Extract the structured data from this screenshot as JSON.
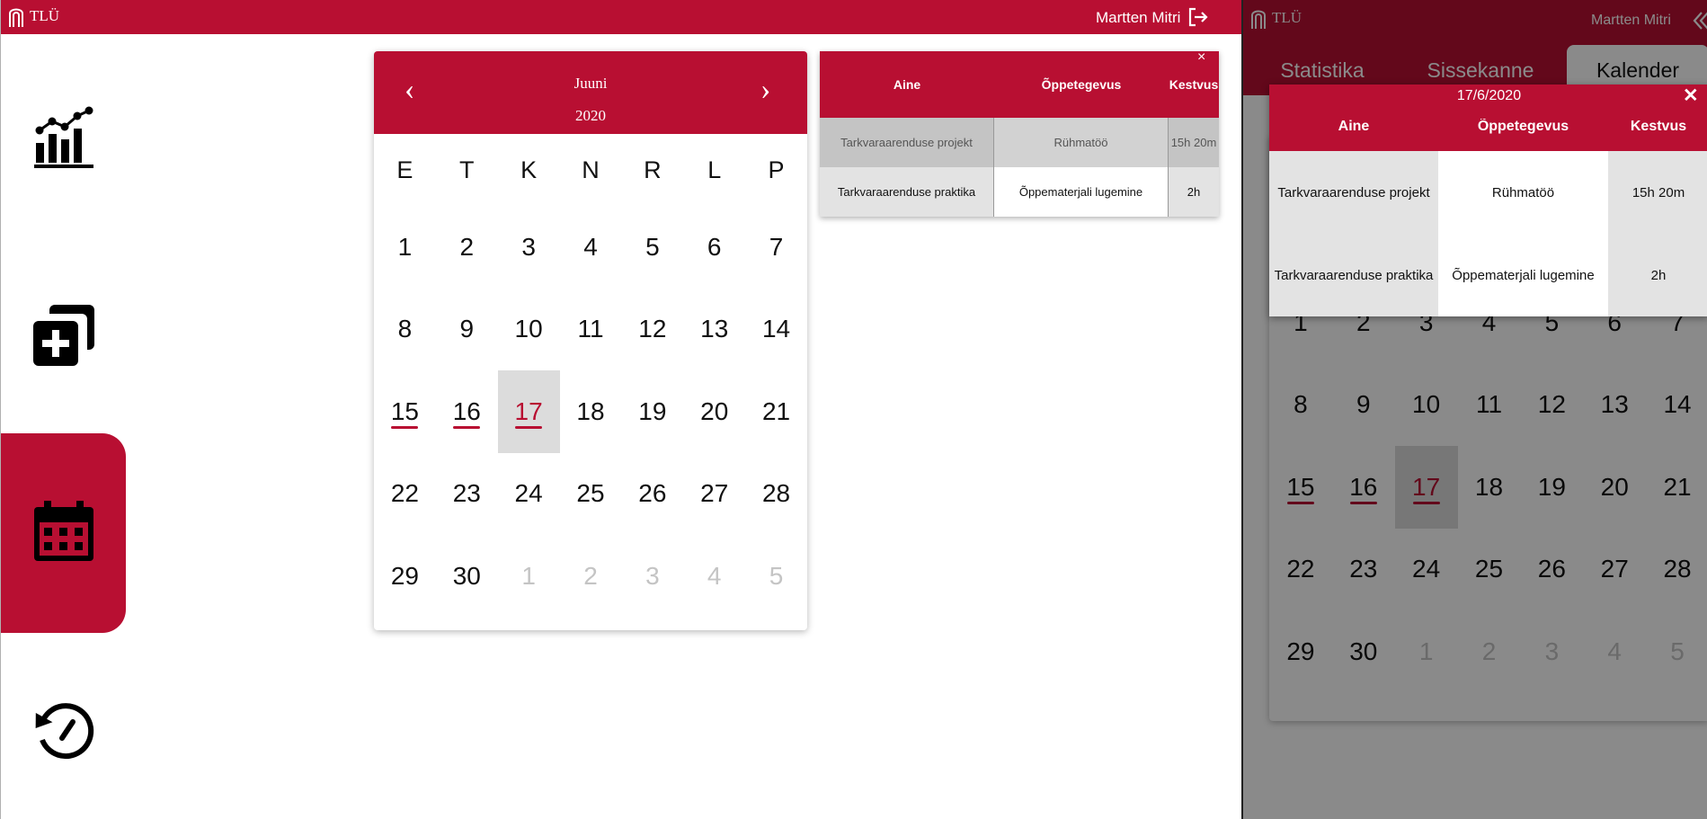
{
  "app": {
    "logo_text": "TLÜ",
    "user_name": "Martten Mitri"
  },
  "nav": {
    "items": [
      {
        "name": "statistics",
        "icon": "chart-icon",
        "active": false
      },
      {
        "name": "new-entry",
        "icon": "add-copy-icon",
        "active": false
      },
      {
        "name": "calendar",
        "icon": "calendar-icon",
        "active": true
      },
      {
        "name": "history",
        "icon": "history-icon",
        "active": false
      }
    ]
  },
  "calendar": {
    "month": "Juuni",
    "year": "2020",
    "prev_symbol": "‹",
    "next_symbol": "›",
    "weekdays": [
      "E",
      "T",
      "K",
      "N",
      "R",
      "L",
      "P"
    ],
    "days": [
      {
        "d": "1"
      },
      {
        "d": "2"
      },
      {
        "d": "3"
      },
      {
        "d": "4"
      },
      {
        "d": "5"
      },
      {
        "d": "6"
      },
      {
        "d": "7"
      },
      {
        "d": "8"
      },
      {
        "d": "9"
      },
      {
        "d": "10"
      },
      {
        "d": "11"
      },
      {
        "d": "12"
      },
      {
        "d": "13"
      },
      {
        "d": "14"
      },
      {
        "d": "15",
        "mark": true
      },
      {
        "d": "16",
        "mark": true
      },
      {
        "d": "17",
        "mark": true,
        "selected": true
      },
      {
        "d": "18"
      },
      {
        "d": "19"
      },
      {
        "d": "20"
      },
      {
        "d": "21"
      },
      {
        "d": "22"
      },
      {
        "d": "23"
      },
      {
        "d": "24"
      },
      {
        "d": "25"
      },
      {
        "d": "26"
      },
      {
        "d": "27"
      },
      {
        "d": "28"
      },
      {
        "d": "29"
      },
      {
        "d": "30"
      },
      {
        "d": "1",
        "muted": true
      },
      {
        "d": "2",
        "muted": true
      },
      {
        "d": "3",
        "muted": true
      },
      {
        "d": "4",
        "muted": true
      },
      {
        "d": "5",
        "muted": true
      }
    ]
  },
  "activities": {
    "close_label": "×",
    "date": "17/6/2020",
    "columns": [
      "Aine",
      "Õppetegevus",
      "Kestvus"
    ],
    "rows": [
      {
        "subject": "Tarkvaraarenduse projekt",
        "activity": "Rühmatöö",
        "duration": "15h 20m"
      },
      {
        "subject": "Tarkvaraarenduse praktika",
        "activity": "Õppematerjali lugemine",
        "duration": "2h"
      }
    ]
  },
  "mobile": {
    "tabs": [
      "Statistika",
      "Sissekanne",
      "Kalender"
    ],
    "active_tab": 2,
    "close_label": "✕"
  },
  "colors": {
    "brand": "#b80f32",
    "selected_bg": "#dcdcdc",
    "muted": "#c4c4c4"
  }
}
